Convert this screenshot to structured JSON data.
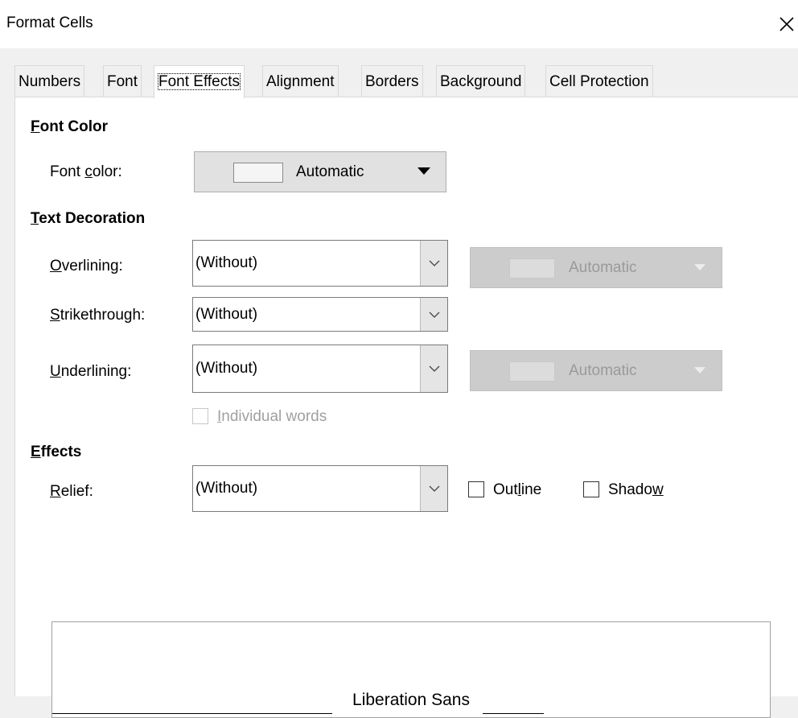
{
  "window": {
    "title": "Format Cells",
    "close_symbol": "✕"
  },
  "tabs": [
    {
      "label": "Numbers"
    },
    {
      "label": "Font"
    },
    {
      "label": "Font Effects",
      "active": true
    },
    {
      "label": "Alignment"
    },
    {
      "label": "Borders"
    },
    {
      "label": "Background"
    },
    {
      "label": "Cell Protection"
    }
  ],
  "font_color": {
    "heading_first": "F",
    "heading_rest": "ont Color",
    "label_a": "Font ",
    "label_u": "c",
    "label_b": "olor:",
    "value": "Automatic"
  },
  "text_decoration": {
    "heading_first": "T",
    "heading_rest": "ext Decoration",
    "overlining": {
      "label_u": "O",
      "label_rest": "verlining:",
      "value": "(Without)",
      "color_value": "Automatic"
    },
    "strikethrough": {
      "label_u": "S",
      "label_rest": "trikethrough:",
      "value": "(Without)"
    },
    "underlining": {
      "label_u": "U",
      "label_rest": "nderlining:",
      "value": "(Without)",
      "color_value": "Automatic"
    },
    "individual_words": {
      "label_u": "I",
      "label_rest": "ndividual words"
    }
  },
  "effects": {
    "heading_first": "E",
    "heading_rest": "ffects",
    "relief": {
      "label_u": "R",
      "label_rest": "elief:",
      "value": "(Without)"
    },
    "outline": {
      "label_a": "Out",
      "label_u": "l",
      "label_b": "ine"
    },
    "shadow": {
      "label_a": "Shado",
      "label_u": "w"
    }
  },
  "preview": {
    "text": "Liberation Sans"
  }
}
